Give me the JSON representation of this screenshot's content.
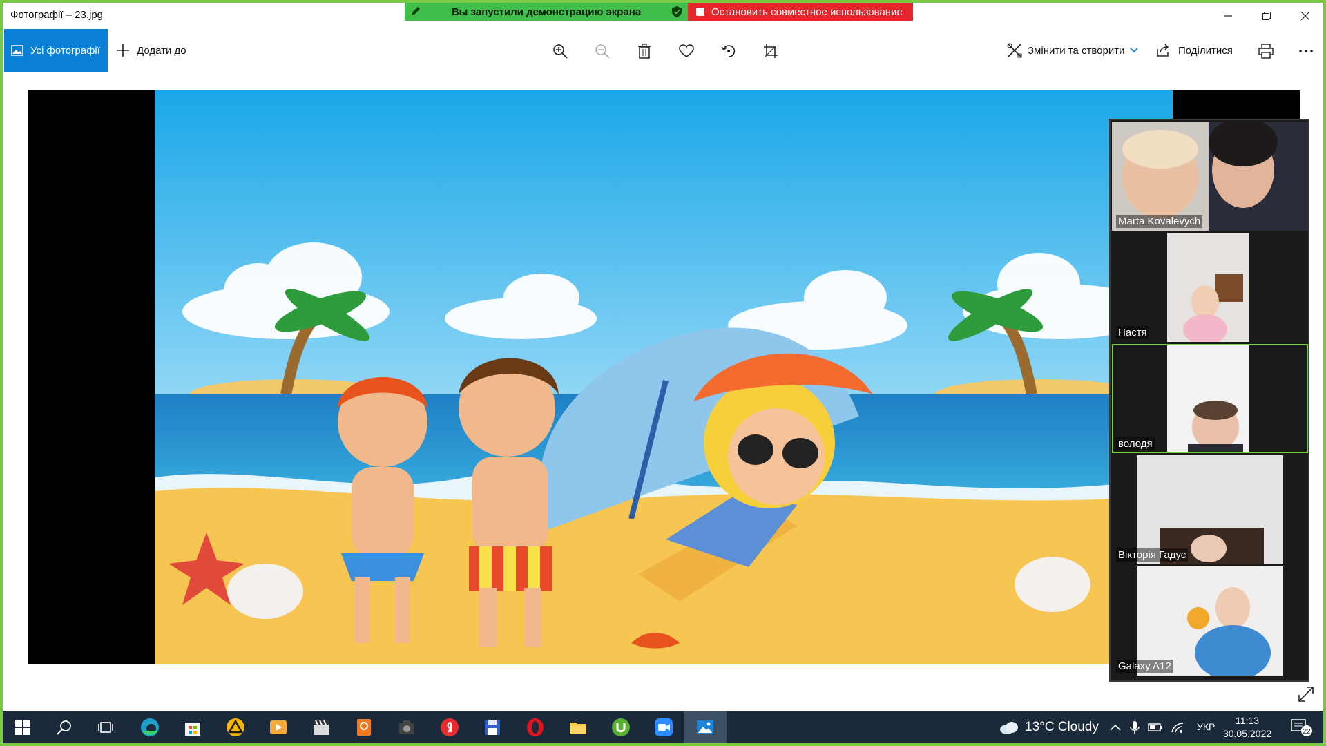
{
  "window": {
    "title": "Фотографії – 23.jpg"
  },
  "share_banner": {
    "status_text": "Вы запустили демонстрацию экрана",
    "stop_text": "Остановить совместное использование"
  },
  "toolbar": {
    "all_photos": "Усі фотографії",
    "add_to": "Додати до",
    "edit_create": "Змінити та створити",
    "share": "Поділитися"
  },
  "participants": [
    {
      "name": "Marta Kovalevych"
    },
    {
      "name": "Настя"
    },
    {
      "name": "володя"
    },
    {
      "name": "Вікторія Гадус"
    },
    {
      "name": "Galaxy A12"
    }
  ],
  "taskbar": {
    "weather": "13°C  Cloudy",
    "language": "УКР",
    "time": "11:13",
    "date": "30.05.2022",
    "notifications": "22"
  },
  "colors": {
    "accent": "#0a7fd6",
    "share_green": "#3fbe49",
    "stop_red": "#e5262a",
    "frame_green": "#7ac943",
    "taskbar": "#1b2a3a"
  }
}
